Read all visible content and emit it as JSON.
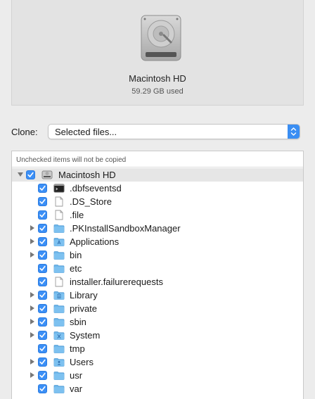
{
  "source": {
    "name": "Macintosh HD",
    "usage": "59.29 GB used"
  },
  "clone": {
    "label": "Clone:",
    "selected": "Selected files..."
  },
  "tree": {
    "header": "Unchecked items will not be copied",
    "root": {
      "name": "Macintosh HD",
      "checked": true,
      "expanded": true,
      "icon": "hard-drive-icon"
    },
    "items": [
      {
        "name": ".dbfseventsd",
        "icon": "terminal-icon",
        "checked": true,
        "expandable": false
      },
      {
        "name": ".DS_Store",
        "icon": "document-icon",
        "checked": true,
        "expandable": false
      },
      {
        "name": ".file",
        "icon": "document-icon",
        "checked": true,
        "expandable": false
      },
      {
        "name": ".PKInstallSandboxManager",
        "icon": "folder-icon",
        "checked": true,
        "expandable": true
      },
      {
        "name": "Applications",
        "icon": "applications-folder-icon",
        "checked": true,
        "expandable": true
      },
      {
        "name": "bin",
        "icon": "folder-icon",
        "checked": true,
        "expandable": true
      },
      {
        "name": "etc",
        "icon": "folder-icon",
        "checked": true,
        "expandable": false
      },
      {
        "name": "installer.failurerequests",
        "icon": "document-icon",
        "checked": true,
        "expandable": false
      },
      {
        "name": "Library",
        "icon": "library-folder-icon",
        "checked": true,
        "expandable": true
      },
      {
        "name": "private",
        "icon": "folder-icon",
        "checked": true,
        "expandable": true
      },
      {
        "name": "sbin",
        "icon": "folder-icon",
        "checked": true,
        "expandable": true
      },
      {
        "name": "System",
        "icon": "system-folder-icon",
        "checked": true,
        "expandable": true
      },
      {
        "name": "tmp",
        "icon": "folder-icon",
        "checked": true,
        "expandable": false
      },
      {
        "name": "Users",
        "icon": "users-folder-icon",
        "checked": true,
        "expandable": true
      },
      {
        "name": "usr",
        "icon": "folder-icon",
        "checked": true,
        "expandable": true
      },
      {
        "name": "var",
        "icon": "folder-icon",
        "checked": true,
        "expandable": false
      }
    ]
  },
  "colors": {
    "accent": "#3b8ff6",
    "folder": "#6fb7ea",
    "background": "#ececec"
  }
}
